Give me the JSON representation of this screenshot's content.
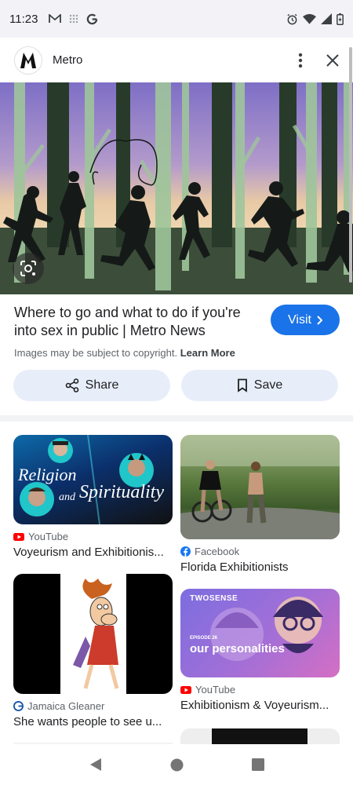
{
  "status_bar": {
    "time": "11:23"
  },
  "header": {
    "site_name": "Metro"
  },
  "hero": {
    "alt": "Silhouettes running through forest"
  },
  "result": {
    "title": "Where to go and what to do if you're into sex in public | Metro News",
    "copyright_note": "Images may be subject to copyright.",
    "learn_more": "Learn More",
    "visit_label": "Visit"
  },
  "actions": {
    "share_label": "Share",
    "save_label": "Save"
  },
  "related": [
    {
      "source": "YouTube",
      "caption": "Voyeurism and Exhibitionis...",
      "thumb_text_1": "Religion",
      "thumb_text_2": "and",
      "thumb_text_3": "Spirituality"
    },
    {
      "source": "Facebook",
      "caption": "Florida Exhibitionists"
    },
    {
      "source": "Jamaica Gleaner",
      "caption": "She wants people to see u..."
    },
    {
      "source": "YouTube",
      "caption": "Exhibitionism & Voyeurism...",
      "thumb_text_1": "TWOSENSE",
      "thumb_text_2": "EPISODE 26",
      "thumb_text_3": "our personalities"
    }
  ],
  "colors": {
    "accent": "#1a73e8",
    "button_bg": "#e8eef9",
    "youtube_red": "#ff0000",
    "facebook_blue": "#1877f2"
  }
}
